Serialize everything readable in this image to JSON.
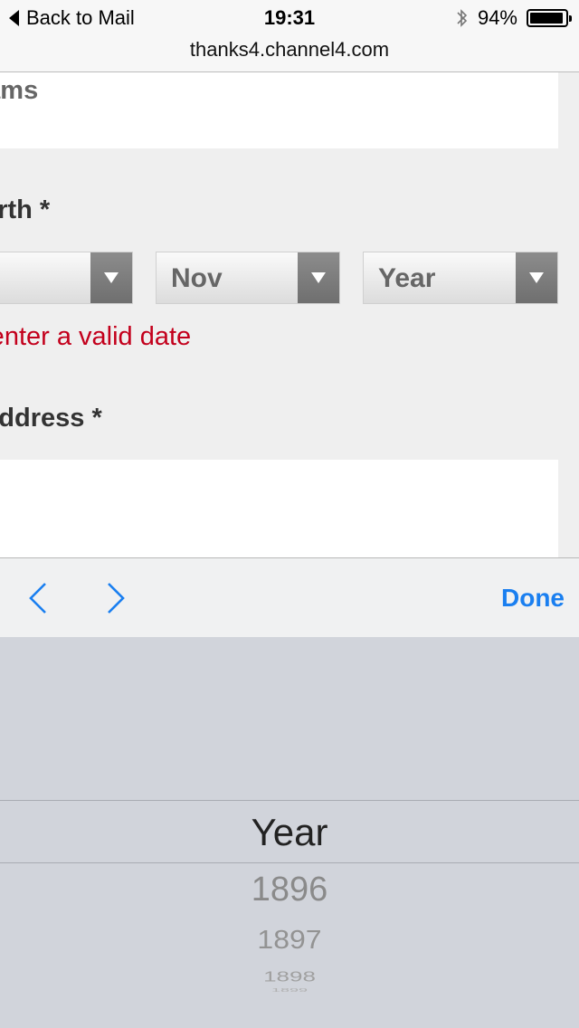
{
  "status_bar": {
    "back_label": "Back to Mail",
    "time": "19:31",
    "battery": "94%",
    "battery_level": 0.94,
    "url": "thanks4.channel4.com",
    "bluetooth_icon": "bluetooth-icon"
  },
  "form": {
    "name_value": "lliams",
    "dob_label": "of birth *",
    "day_value": "",
    "month_value": "Nov",
    "year_value": "Year",
    "error_text": "se enter a valid date",
    "email_label": "il address *",
    "email_value": ""
  },
  "accessory_bar": {
    "prev_icon": "chevron-left-icon",
    "next_icon": "chevron-right-icon",
    "done_label": "Done",
    "accent_color": "#1a7ff0"
  },
  "picker": {
    "selected": "Year",
    "options": [
      "1896",
      "1897",
      "1898",
      "1899"
    ]
  },
  "colors": {
    "error": "#c3001c",
    "background": "#efefef",
    "picker_bg": "#d1d4db"
  }
}
